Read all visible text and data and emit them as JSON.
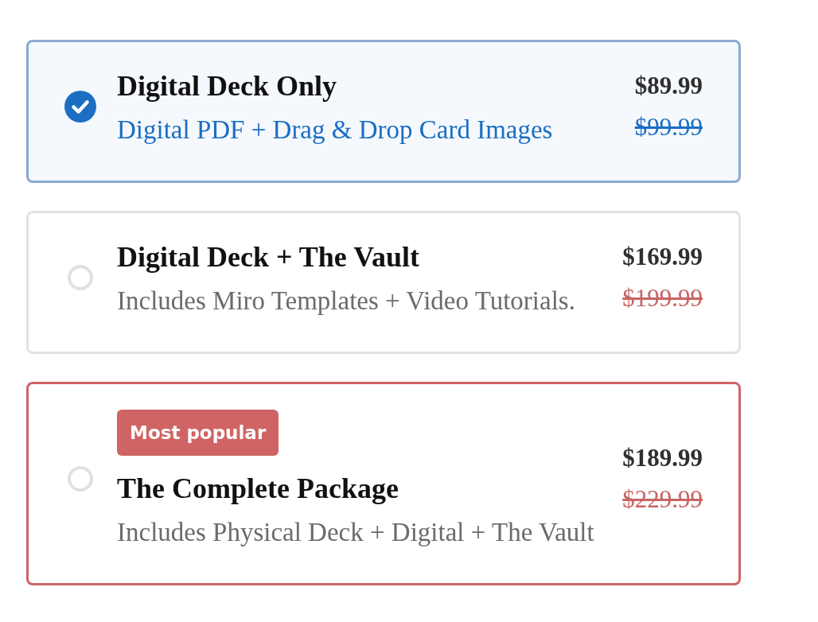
{
  "plans": [
    {
      "title": "Digital Deck Only",
      "description": "Digital PDF + Drag & Drop Card Images",
      "price": "$89.99",
      "original_price": "$99.99",
      "selected": true,
      "featured": false
    },
    {
      "title": "Digital Deck + The Vault",
      "description": "Includes Miro Templates + Video Tutorials.",
      "price": "$169.99",
      "original_price": "$199.99",
      "selected": false,
      "featured": false
    },
    {
      "badge": "Most popular",
      "title": "The Complete Package",
      "description": "Includes Physical Deck + Digital + The Vault",
      "price": "$189.99",
      "original_price": "$229.99",
      "selected": false,
      "featured": true
    }
  ]
}
